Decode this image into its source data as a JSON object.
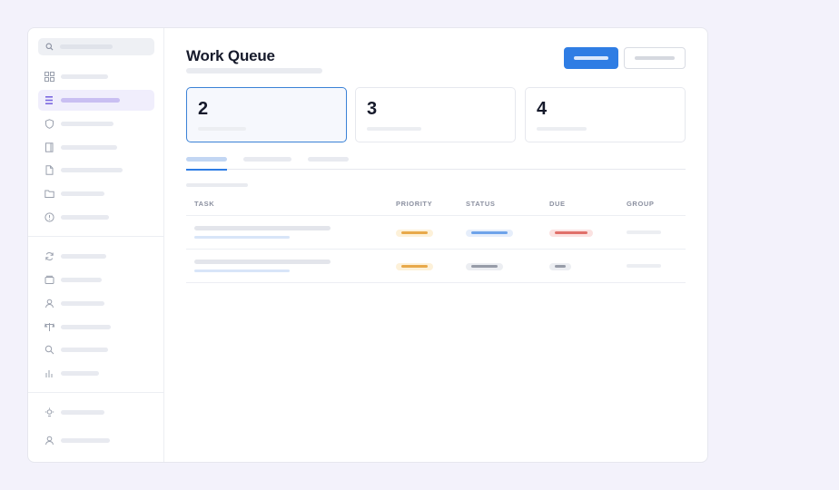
{
  "main": {
    "title": "Work Queue"
  },
  "summary_cards": [
    {
      "value": "2"
    },
    {
      "value": "3"
    },
    {
      "value": "4"
    }
  ],
  "table": {
    "columns": [
      "TASK",
      "PRIORITY",
      "STATUS",
      "DUE",
      "GROUP"
    ]
  },
  "colors": {
    "accent": "#2f7de4",
    "active_nav": "#f0eefc",
    "priority_pill": "#f0a93a",
    "status_blue": "#5b9de8",
    "status_gray": "#8c919c",
    "due_red": "#e0605a",
    "background": "#f3f2fb"
  },
  "icons": [
    "search-icon",
    "grid-icon",
    "list-icon",
    "shield-icon",
    "book-icon",
    "document-icon",
    "folder-icon",
    "info-icon",
    "refresh-icon",
    "wallet-icon",
    "user-icon",
    "scale-icon",
    "search-icon",
    "bar-chart-icon",
    "bulb-icon",
    "user-icon"
  ]
}
